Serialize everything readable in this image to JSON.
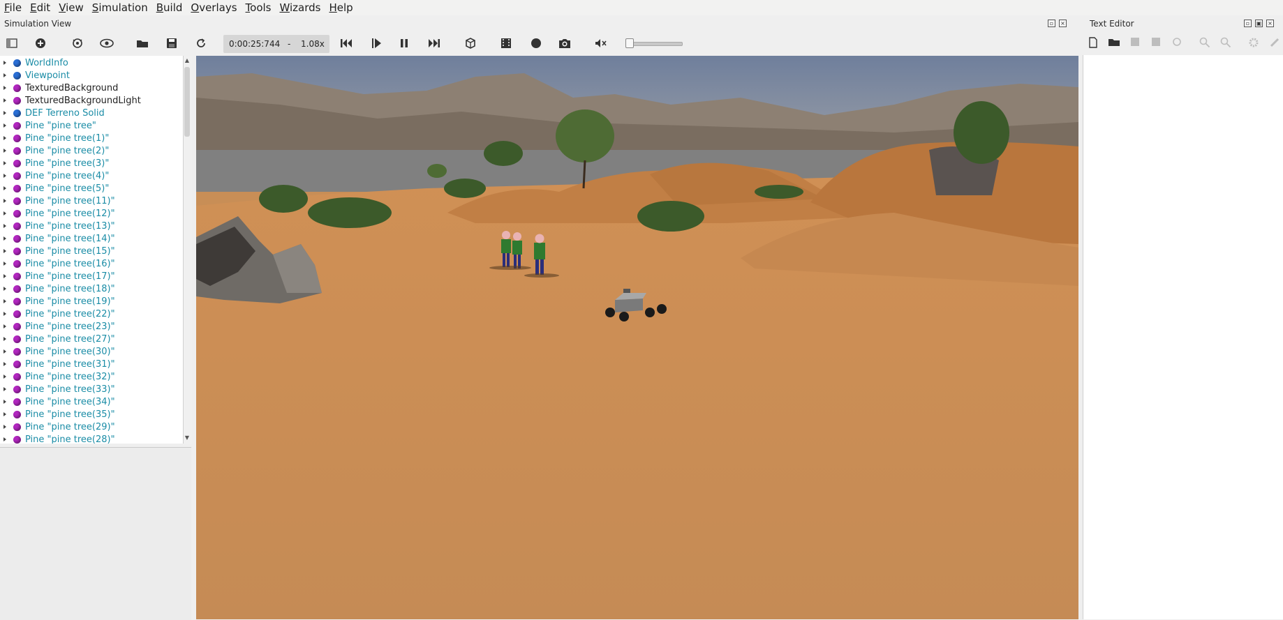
{
  "menu": [
    "File",
    "Edit",
    "View",
    "Simulation",
    "Build",
    "Overlays",
    "Tools",
    "Wizards",
    "Help"
  ],
  "simulation_view": {
    "title": "Simulation View",
    "toolbar": {
      "time": "0:00:25:744",
      "separator": "-",
      "speed": "1.08x",
      "buttons": [
        "toggle-scene-tree-icon",
        "add-node-icon",
        "reset-viewpoint-icon",
        "eye-icon",
        "open-world-icon",
        "save-world-icon",
        "reload-world-icon",
        "step-back-icon",
        "step-icon",
        "pause-icon",
        "fast-forward-icon",
        "view-cube-icon",
        "record-video-icon",
        "record-icon",
        "camera-icon",
        "speaker-mute-icon"
      ]
    },
    "scene_tree": [
      {
        "label": "WorldInfo",
        "color": "#1a8ca6",
        "ball": "#2a6fd6"
      },
      {
        "label": "Viewpoint",
        "color": "#1a8ca6",
        "ball": "#2a6fd6"
      },
      {
        "label": "TexturedBackground",
        "color": "#222222",
        "ball": "#b227c0"
      },
      {
        "label": "TexturedBackgroundLight",
        "color": "#222222",
        "ball": "#b227c0"
      },
      {
        "label": "DEF Terreno Solid",
        "color": "#1a8ca6",
        "ball": "#2a6fd6"
      },
      {
        "label": "Pine \"pine tree\"",
        "color": "#1a8ca6",
        "ball": "#b227c0"
      },
      {
        "label": "Pine \"pine tree(1)\"",
        "color": "#1a8ca6",
        "ball": "#b227c0"
      },
      {
        "label": "Pine \"pine tree(2)\"",
        "color": "#1a8ca6",
        "ball": "#b227c0"
      },
      {
        "label": "Pine \"pine tree(3)\"",
        "color": "#1a8ca6",
        "ball": "#b227c0"
      },
      {
        "label": "Pine \"pine tree(4)\"",
        "color": "#1a8ca6",
        "ball": "#b227c0"
      },
      {
        "label": "Pine \"pine tree(5)\"",
        "color": "#1a8ca6",
        "ball": "#b227c0"
      },
      {
        "label": "Pine \"pine tree(11)\"",
        "color": "#1a8ca6",
        "ball": "#b227c0"
      },
      {
        "label": "Pine \"pine tree(12)\"",
        "color": "#1a8ca6",
        "ball": "#b227c0"
      },
      {
        "label": "Pine \"pine tree(13)\"",
        "color": "#1a8ca6",
        "ball": "#b227c0"
      },
      {
        "label": "Pine \"pine tree(14)\"",
        "color": "#1a8ca6",
        "ball": "#b227c0"
      },
      {
        "label": "Pine \"pine tree(15)\"",
        "color": "#1a8ca6",
        "ball": "#b227c0"
      },
      {
        "label": "Pine \"pine tree(16)\"",
        "color": "#1a8ca6",
        "ball": "#b227c0"
      },
      {
        "label": "Pine \"pine tree(17)\"",
        "color": "#1a8ca6",
        "ball": "#b227c0"
      },
      {
        "label": "Pine \"pine tree(18)\"",
        "color": "#1a8ca6",
        "ball": "#b227c0"
      },
      {
        "label": "Pine \"pine tree(19)\"",
        "color": "#1a8ca6",
        "ball": "#b227c0"
      },
      {
        "label": "Pine \"pine tree(22)\"",
        "color": "#1a8ca6",
        "ball": "#b227c0"
      },
      {
        "label": "Pine \"pine tree(23)\"",
        "color": "#1a8ca6",
        "ball": "#b227c0"
      },
      {
        "label": "Pine \"pine tree(27)\"",
        "color": "#1a8ca6",
        "ball": "#b227c0"
      },
      {
        "label": "Pine \"pine tree(30)\"",
        "color": "#1a8ca6",
        "ball": "#b227c0"
      },
      {
        "label": "Pine \"pine tree(31)\"",
        "color": "#1a8ca6",
        "ball": "#b227c0"
      },
      {
        "label": "Pine \"pine tree(32)\"",
        "color": "#1a8ca6",
        "ball": "#b227c0"
      },
      {
        "label": "Pine \"pine tree(33)\"",
        "color": "#1a8ca6",
        "ball": "#b227c0"
      },
      {
        "label": "Pine \"pine tree(34)\"",
        "color": "#1a8ca6",
        "ball": "#b227c0"
      },
      {
        "label": "Pine \"pine tree(35)\"",
        "color": "#1a8ca6",
        "ball": "#b227c0"
      },
      {
        "label": "Pine \"pine tree(29)\"",
        "color": "#1a8ca6",
        "ball": "#b227c0"
      },
      {
        "label": "Pine \"pine tree(28)\"",
        "color": "#1a8ca6",
        "ball": "#b227c0"
      }
    ]
  },
  "text_editor": {
    "title": "Text Editor",
    "buttons": [
      "new-file-icon",
      "open-file-icon",
      "save-file-icon",
      "save-as-icon",
      "revert-icon",
      "find-icon",
      "replace-icon",
      "settings-icon",
      "clear-icon"
    ]
  },
  "colors": {
    "sand": "#c88e56",
    "sky": "#7d8aa0",
    "node_blue": "#2a6fd6",
    "node_purple": "#b227c0",
    "tree_text": "#1a8ca6"
  }
}
